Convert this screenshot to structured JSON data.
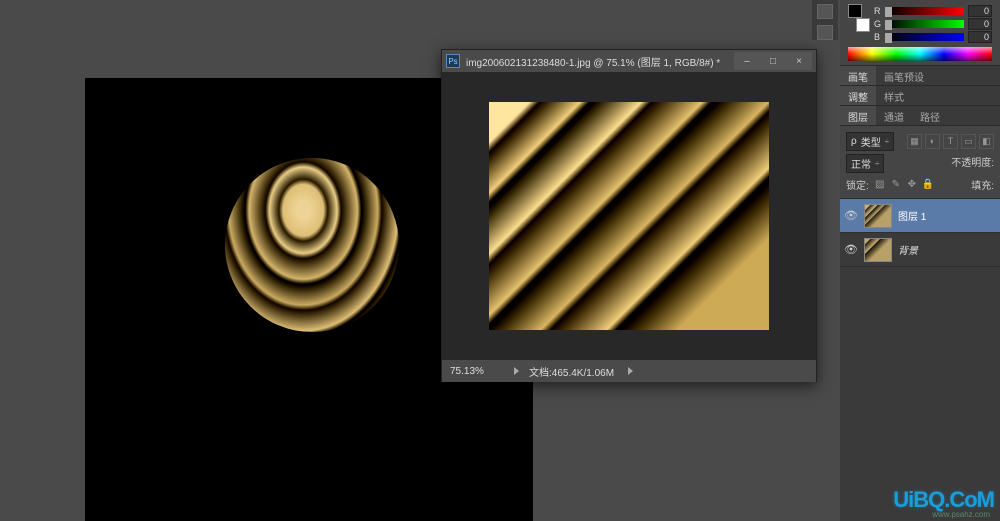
{
  "main_canvas": {
    "name": "black-circle-document"
  },
  "doc_window": {
    "title": "img200602131238480-1.jpg @ 75.1% (图层 1, RGB/8#) *",
    "zoom": "75.13%",
    "doc_info": "文档:465.4K/1.06M"
  },
  "color_panel": {
    "r": {
      "label": "R",
      "value": "0"
    },
    "g": {
      "label": "G",
      "value": "0"
    },
    "b": {
      "label": "B",
      "value": "0"
    }
  },
  "tabs": {
    "brush": "画笔",
    "brush_presets": "画笔预设",
    "adjustments": "调整",
    "styles": "样式",
    "layers": "图层",
    "channels": "通道",
    "paths": "路径"
  },
  "layers_panel": {
    "kind_label": "类型",
    "blend_mode": "正常",
    "opacity_label": "不透明度:",
    "lock_label": "锁定:",
    "fill_label": "填充:",
    "layers": [
      {
        "name": "图层 1",
        "selected": true
      },
      {
        "name": "背景",
        "italic": true
      }
    ]
  },
  "watermark": "UiBQ.CoM",
  "watermark_sub": "www.psahz.com"
}
